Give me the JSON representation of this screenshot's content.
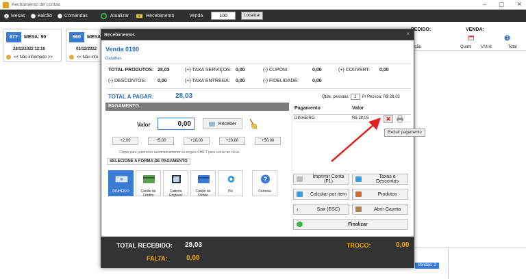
{
  "window": {
    "title": "Fechamento de contas",
    "min": "–",
    "max": "▢",
    "close": "✕"
  },
  "toolbar": {
    "radio_mesas": "Mesas",
    "radio_balcao": "Balcão",
    "radio_comandas": "Comandas",
    "atualizar": "Atualizar",
    "recebimento": "Recebimento",
    "venda_label": "Venda",
    "venda_value": "100",
    "localizar": "Localizar"
  },
  "cards": [
    {
      "num": "677",
      "mesa": "MESA: 90",
      "date": "28/11/2022 12:16",
      "info": "<< Não informado >>"
    },
    {
      "num": "960",
      "mesa": "MESA:",
      "date": "03/12/2022",
      "info": "<< Não info"
    }
  ],
  "right_panel": {
    "pedido": "PEDIDO:",
    "venda": "VENDA:",
    "col_descricao": "rição",
    "col_quant": "Quant",
    "col_vunit": "V.Unit",
    "col_total": "Total",
    "vendas_badge": "Vendas: 2"
  },
  "modal": {
    "title": "Recebimentos",
    "close": "×",
    "venda_title": "Venda 0100",
    "detalhes": "Detalhes",
    "totals": {
      "total_produtos_lbl": "TOTAL PRODUTOS:",
      "total_produtos_val": "28,03",
      "taxa_servicos_lbl": "(+) TAXA SERVIÇOS:",
      "taxa_servicos_val": "0,00",
      "cupom_lbl": "(-) CUPOM:",
      "cupom_val": "0,00",
      "couvert_lbl": "(+) COUVERT:",
      "couvert_val": "0,00",
      "descontos_lbl": "(-) DESCONTOS:",
      "descontos_val": "0,00",
      "taxa_entrega_lbl": "(+) TAXA ENTREGA:",
      "taxa_entrega_val": "0,00",
      "fidelidade_lbl": "(-) FIDELIDADE:",
      "fidelidade_val": "0,00"
    },
    "total_pagar_lbl": "TOTAL A PAGAR:",
    "total_pagar_val": "28,03",
    "qtde_lbl": "Qtde. pessoas",
    "qtde_val": "1",
    "por_pessoa": "P/ Pessoa: R$ 28,03",
    "pagamento_bar": "PAGAMENTO",
    "valor_lbl": "Valor",
    "valor_val": "0,00",
    "receber": "Receber",
    "quick": [
      "+2,00",
      "+5,00",
      "+10,00",
      "+20,00",
      "+50,00"
    ],
    "hint": "Clique para preencher automaticamente ou segure  SHIFT  para somar ao clicar.",
    "sel_forma": "SELECIONE A FORMA DE PAGAMENTO",
    "pay_methods": [
      "DINHEIRO",
      "Cartão de Crédito",
      "Carteira Engfood",
      "Cartão de Débito",
      "Pix",
      "Cortesia"
    ],
    "pg_col_pagamento": "Pagamento",
    "pg_col_valor": "Valor",
    "pg_row_name": "DINHEIRO",
    "pg_row_val": "R$ 28,03",
    "del_symbol": "✕",
    "tooltip": "Excluir pagamento",
    "actions": {
      "imprimir": "Imprimir Conta (F1)",
      "taxas": "Taxas e Descontos",
      "calcular": "Calcular por item",
      "produtos": "Produtos",
      "sair": "Sair  (ESC)",
      "gaveta": "Abrir Gaveta",
      "finalizar": "Finalizar"
    },
    "total_recebido_lbl": "TOTAL RECEBIDO:",
    "total_recebido_val": "28,03",
    "falta_lbl": "FALTA:",
    "falta_val": "0,00",
    "troco_lbl": "TROCO:",
    "troco_val": "0,00"
  },
  "colors": {
    "accent": "#3a7bd5",
    "warning": "#f0a800",
    "danger": "#cc0000",
    "dark": "#333333"
  }
}
